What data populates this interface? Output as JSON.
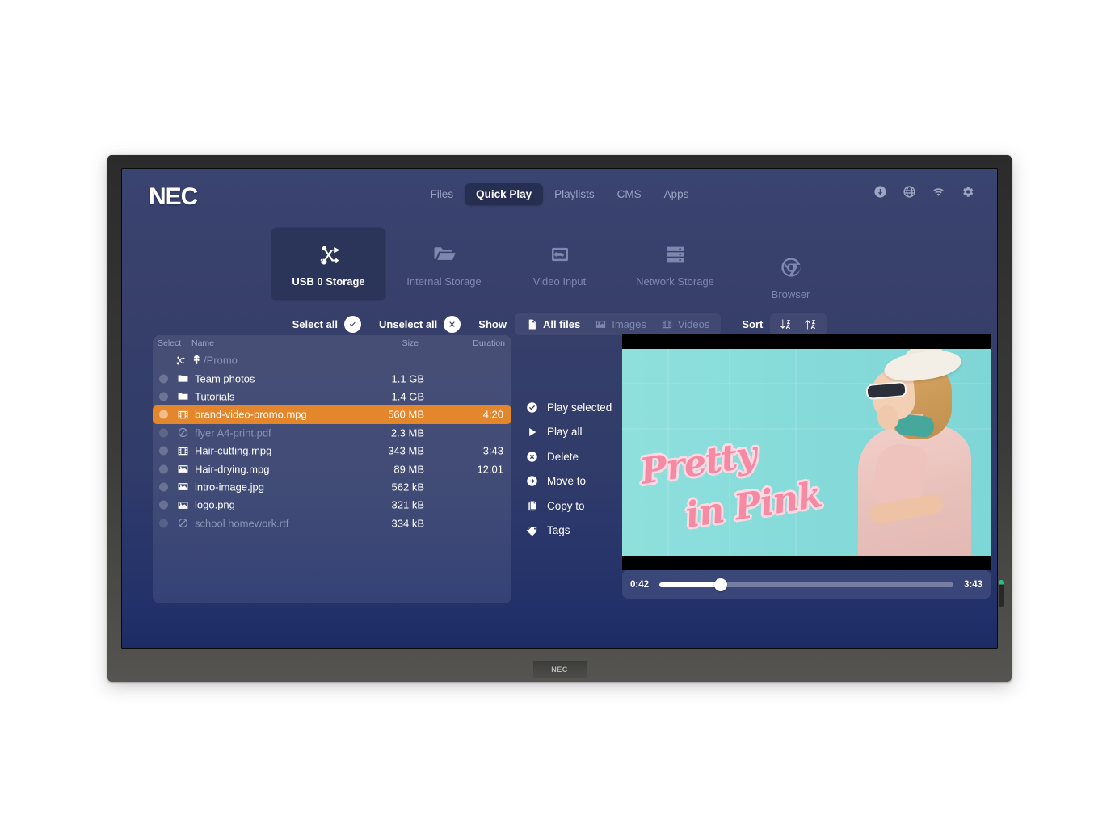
{
  "brand": {
    "logo": "NEC",
    "bezel_logo": "NEC"
  },
  "nav": {
    "items": [
      {
        "label": "Files",
        "active": false
      },
      {
        "label": "Quick Play",
        "active": true
      },
      {
        "label": "Playlists",
        "active": false
      },
      {
        "label": "CMS",
        "active": false
      },
      {
        "label": "Apps",
        "active": false
      }
    ],
    "icons": [
      {
        "name": "download-icon"
      },
      {
        "name": "globe-icon"
      },
      {
        "name": "wifi-icon"
      },
      {
        "name": "gear-icon"
      }
    ]
  },
  "sources": [
    {
      "label": "USB 0 Storage",
      "icon": "usb-icon",
      "active": true
    },
    {
      "label": "Internal Storage",
      "icon": "folder-icon",
      "active": false
    },
    {
      "label": "Video Input",
      "icon": "video-input-icon",
      "active": false
    },
    {
      "label": "Network Storage",
      "icon": "server-icon",
      "active": false
    },
    {
      "label": "Browser",
      "icon": "browser-chrome-icon",
      "active": false
    }
  ],
  "toolbar": {
    "select_all_label": "Select all",
    "unselect_all_label": "Unselect all",
    "show_label": "Show",
    "filters": [
      {
        "label": "All files",
        "icon": "document-icon",
        "active": true
      },
      {
        "label": "Images",
        "icon": "image-icon",
        "active": false
      },
      {
        "label": "Videos",
        "icon": "film-icon",
        "active": false
      }
    ],
    "sort_label": "Sort",
    "sort_buttons": [
      {
        "name": "sort-descending-az-icon"
      },
      {
        "name": "sort-ascending-az-icon"
      }
    ]
  },
  "file_list": {
    "columns": {
      "select": "Select",
      "name": "Name",
      "size": "Size",
      "duration": "Duration"
    },
    "path": "/Promo",
    "rows": [
      {
        "name": "Team photos",
        "size": "1.1 GB",
        "duration": "",
        "icon": "folder-icon",
        "dim": false,
        "selected": false
      },
      {
        "name": "Tutorials",
        "size": "1.4 GB",
        "duration": "",
        "icon": "folder-icon",
        "dim": false,
        "selected": false
      },
      {
        "name": "brand-video-promo.mpg",
        "size": "560 MB",
        "duration": "4:20",
        "icon": "film-icon",
        "dim": false,
        "selected": true
      },
      {
        "name": "flyer A4-print.pdf",
        "size": "2.3 MB",
        "duration": "",
        "icon": "blocked-icon",
        "dim": true,
        "selected": false
      },
      {
        "name": "Hair-cutting.mpg",
        "size": "343 MB",
        "duration": "3:43",
        "icon": "film-icon",
        "dim": false,
        "selected": false
      },
      {
        "name": "Hair-drying.mpg",
        "size": "89 MB",
        "duration": "12:01",
        "icon": "image-icon",
        "dim": false,
        "selected": false
      },
      {
        "name": "intro-image.jpg",
        "size": "562 kB",
        "duration": "",
        "icon": "image-icon",
        "dim": false,
        "selected": false
      },
      {
        "name": "logo.png",
        "size": "321 kB",
        "duration": "",
        "icon": "image-icon",
        "dim": false,
        "selected": false
      },
      {
        "name": "school homework.rtf",
        "size": "334 kB",
        "duration": "",
        "icon": "blocked-icon",
        "dim": true,
        "selected": false
      }
    ]
  },
  "actions": [
    {
      "label": "Play selected",
      "icon": "check-circle-icon"
    },
    {
      "label": "Play all",
      "icon": "play-icon"
    },
    {
      "label": "Delete",
      "icon": "x-circle-icon"
    },
    {
      "label": "Move to",
      "icon": "arrow-right-circle-icon"
    },
    {
      "label": "Copy to",
      "icon": "copy-icon"
    },
    {
      "label": "Tags",
      "icon": "tag-icon"
    }
  ],
  "preview": {
    "overlay_line1": "Pretty",
    "overlay_line2": "in Pink",
    "current_time": "0:42",
    "total_time": "3:43",
    "progress_percent": 21
  },
  "colors": {
    "screen_top": "#3a4470",
    "screen_bottom": "#1d2b65",
    "selected_row": "#e4862b",
    "active_tile": "#2b3459",
    "muted_text": "#8b93b4",
    "video_bg": "#87dcda",
    "script_pink": "#f48aa4"
  }
}
